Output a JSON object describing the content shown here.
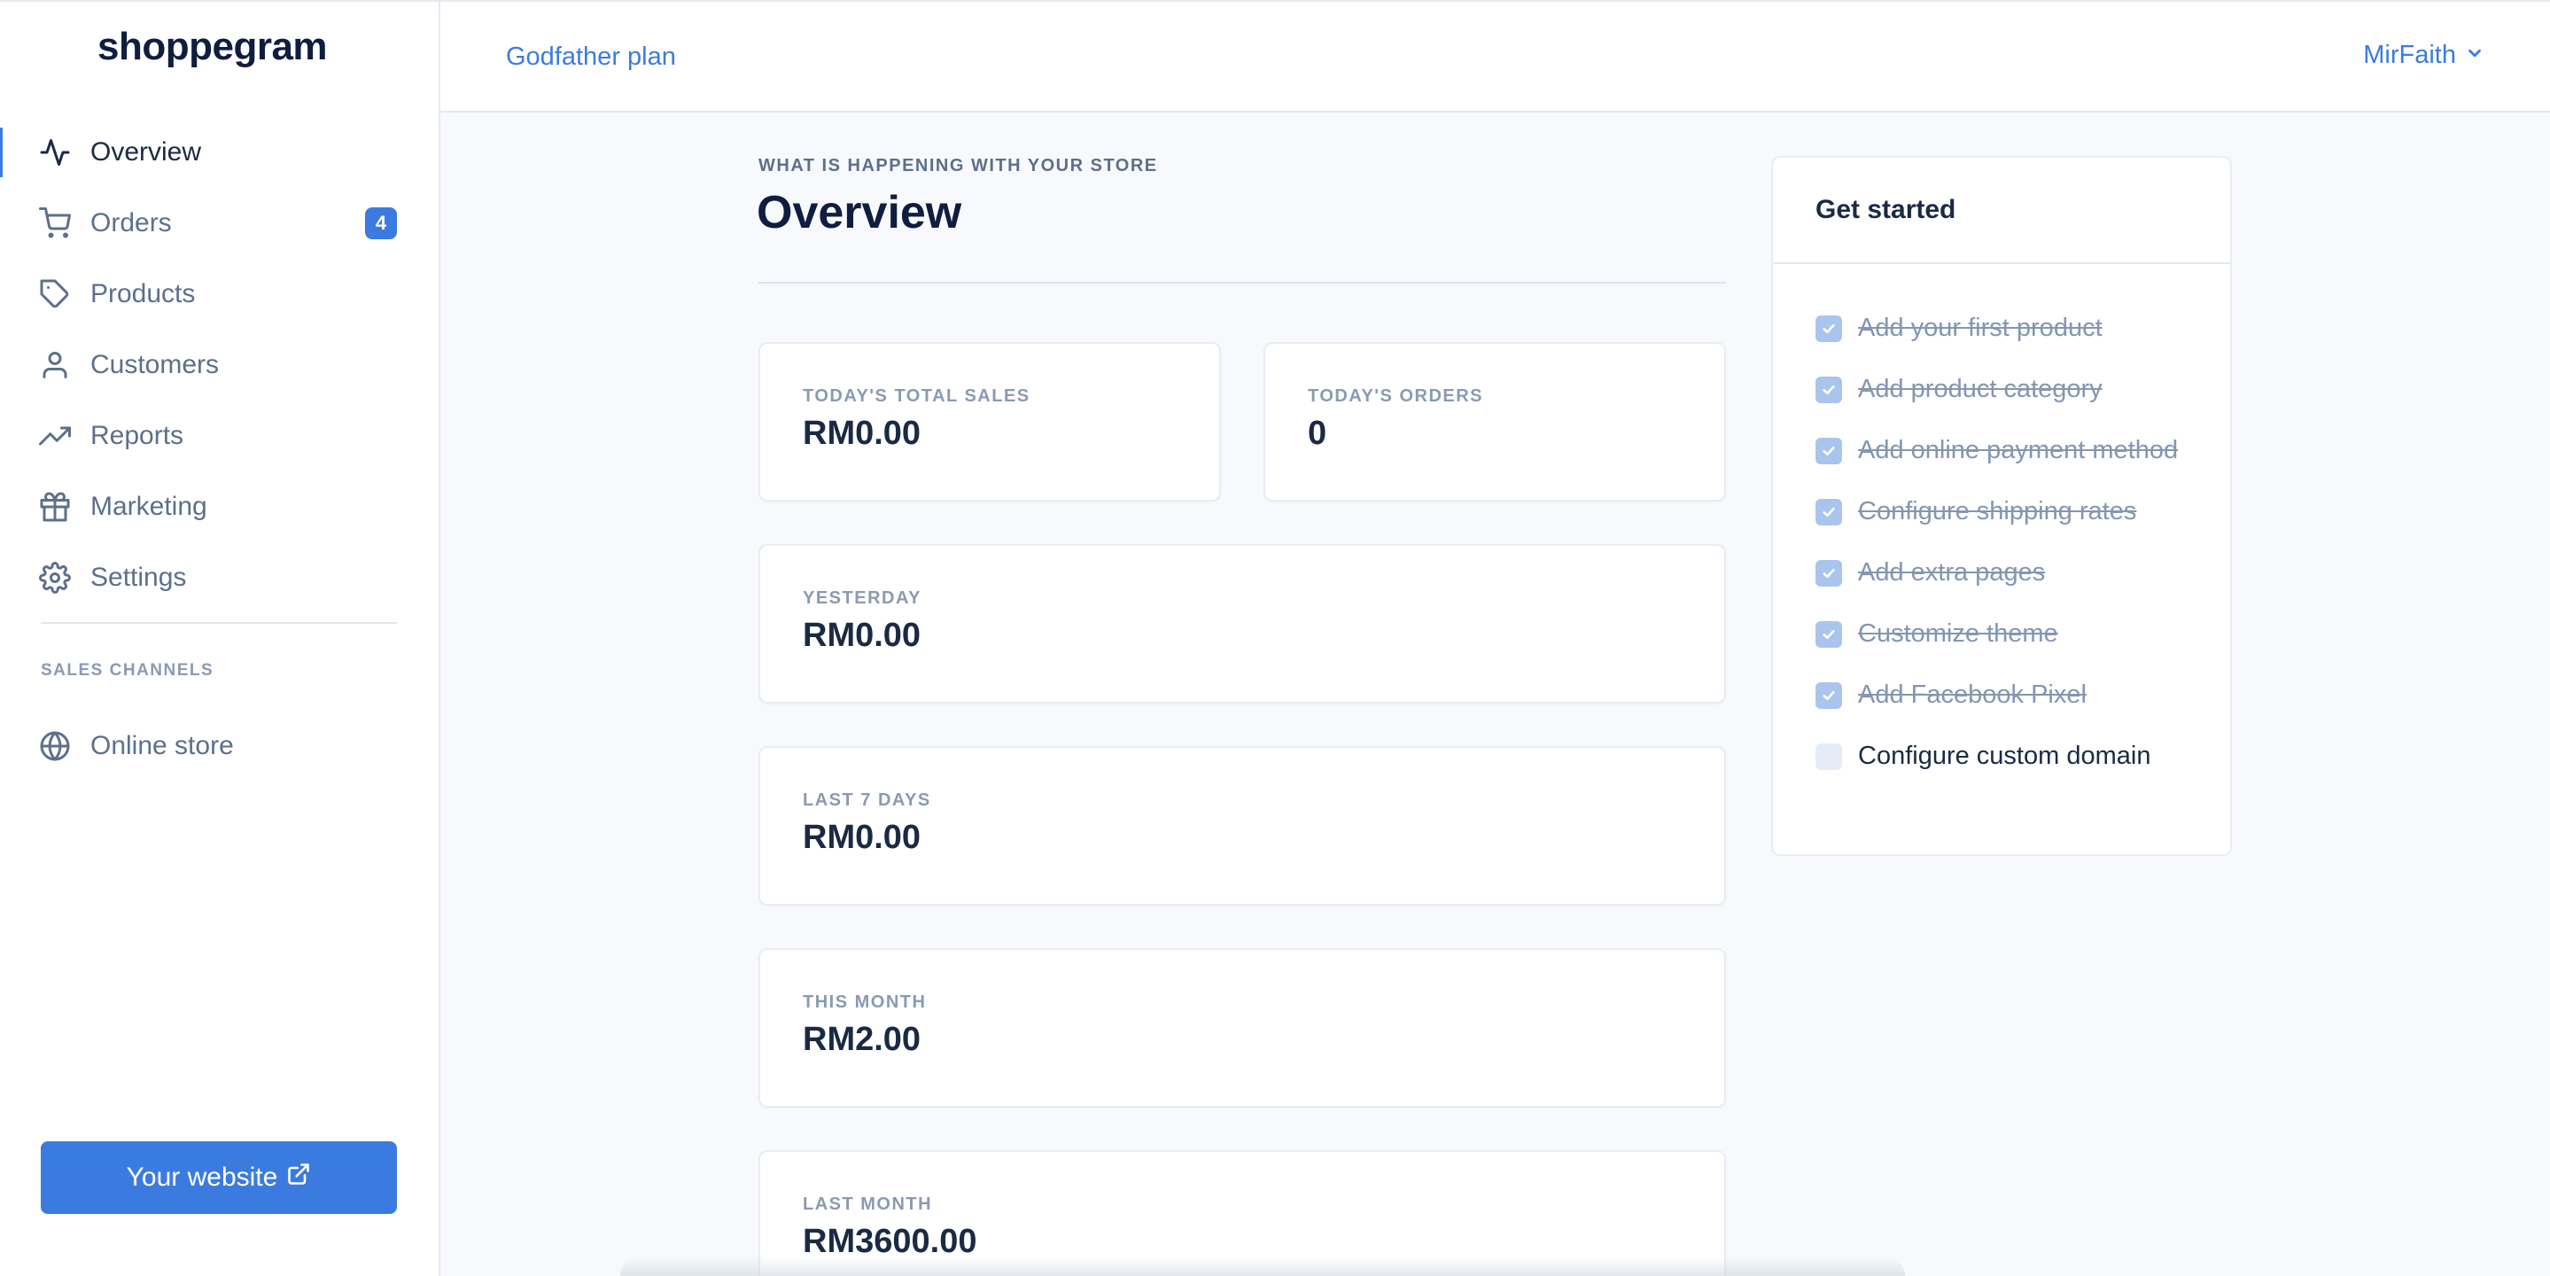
{
  "brand": {
    "name": "shoppegram"
  },
  "sidebar": {
    "items": [
      {
        "label": "Overview",
        "icon": "activity-icon",
        "active": true
      },
      {
        "label": "Orders",
        "icon": "cart-icon",
        "badge": "4"
      },
      {
        "label": "Products",
        "icon": "tag-icon"
      },
      {
        "label": "Customers",
        "icon": "user-icon"
      },
      {
        "label": "Reports",
        "icon": "trending-up-icon"
      },
      {
        "label": "Marketing",
        "icon": "gift-icon"
      },
      {
        "label": "Settings",
        "icon": "gear-icon"
      }
    ],
    "channels_title": "SALES CHANNELS",
    "channels": [
      {
        "label": "Online store",
        "icon": "globe-icon"
      }
    ],
    "website_button": "Your website"
  },
  "topbar": {
    "plan": "Godfather plan",
    "user": "MirFaith"
  },
  "main": {
    "eyebrow": "WHAT IS HAPPENING WITH YOUR STORE",
    "title": "Overview",
    "stats": [
      {
        "label": "TODAY'S TOTAL SALES",
        "value": "RM0.00"
      },
      {
        "label": "TODAY'S ORDERS",
        "value": "0"
      },
      {
        "label": "YESTERDAY",
        "value": "RM0.00"
      },
      {
        "label": "LAST 7 DAYS",
        "value": "RM0.00"
      },
      {
        "label": "THIS MONTH",
        "value": "RM2.00"
      },
      {
        "label": "LAST MONTH",
        "value": "RM3600.00"
      }
    ]
  },
  "get_started": {
    "title": "Get started",
    "items": [
      {
        "label": "Add your first product",
        "done": true
      },
      {
        "label": "Add product category",
        "done": true
      },
      {
        "label": "Add online payment method",
        "done": true
      },
      {
        "label": "Configure shipping rates",
        "done": true
      },
      {
        "label": "Add extra pages",
        "done": true
      },
      {
        "label": "Customize theme",
        "done": true
      },
      {
        "label": "Add Facebook Pixel",
        "done": true
      },
      {
        "label": "Configure custom domain",
        "done": false
      }
    ]
  },
  "colors": {
    "accent": "#3b7be0",
    "text": "#1a2a44",
    "muted": "#8a9ab2",
    "background": "#f7f9fc"
  }
}
